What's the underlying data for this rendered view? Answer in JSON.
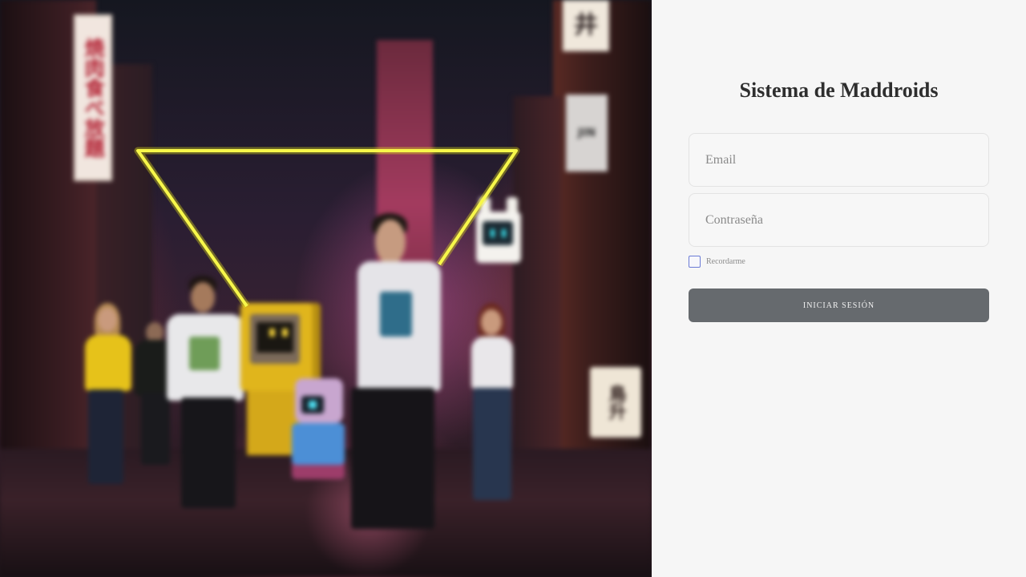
{
  "hero": {
    "sign_left_text": "焼肉食べ放題",
    "sign_top_text": "井",
    "sign_jin_text": "JIN",
    "sign_right_text": "鳥升"
  },
  "login": {
    "title": "Sistema de Maddroids",
    "email": {
      "placeholder": "Email",
      "value": ""
    },
    "password": {
      "placeholder": "Contraseña",
      "value": ""
    },
    "remember": {
      "label": "Recordarme",
      "checked": false
    },
    "submit_label": "INICIAR SESIÓN"
  },
  "colors": {
    "panel_bg": "#f6f6f6",
    "button_bg": "#666a6e",
    "checkbox_border": "#6b7bd6",
    "neon": "#f2f21a"
  }
}
